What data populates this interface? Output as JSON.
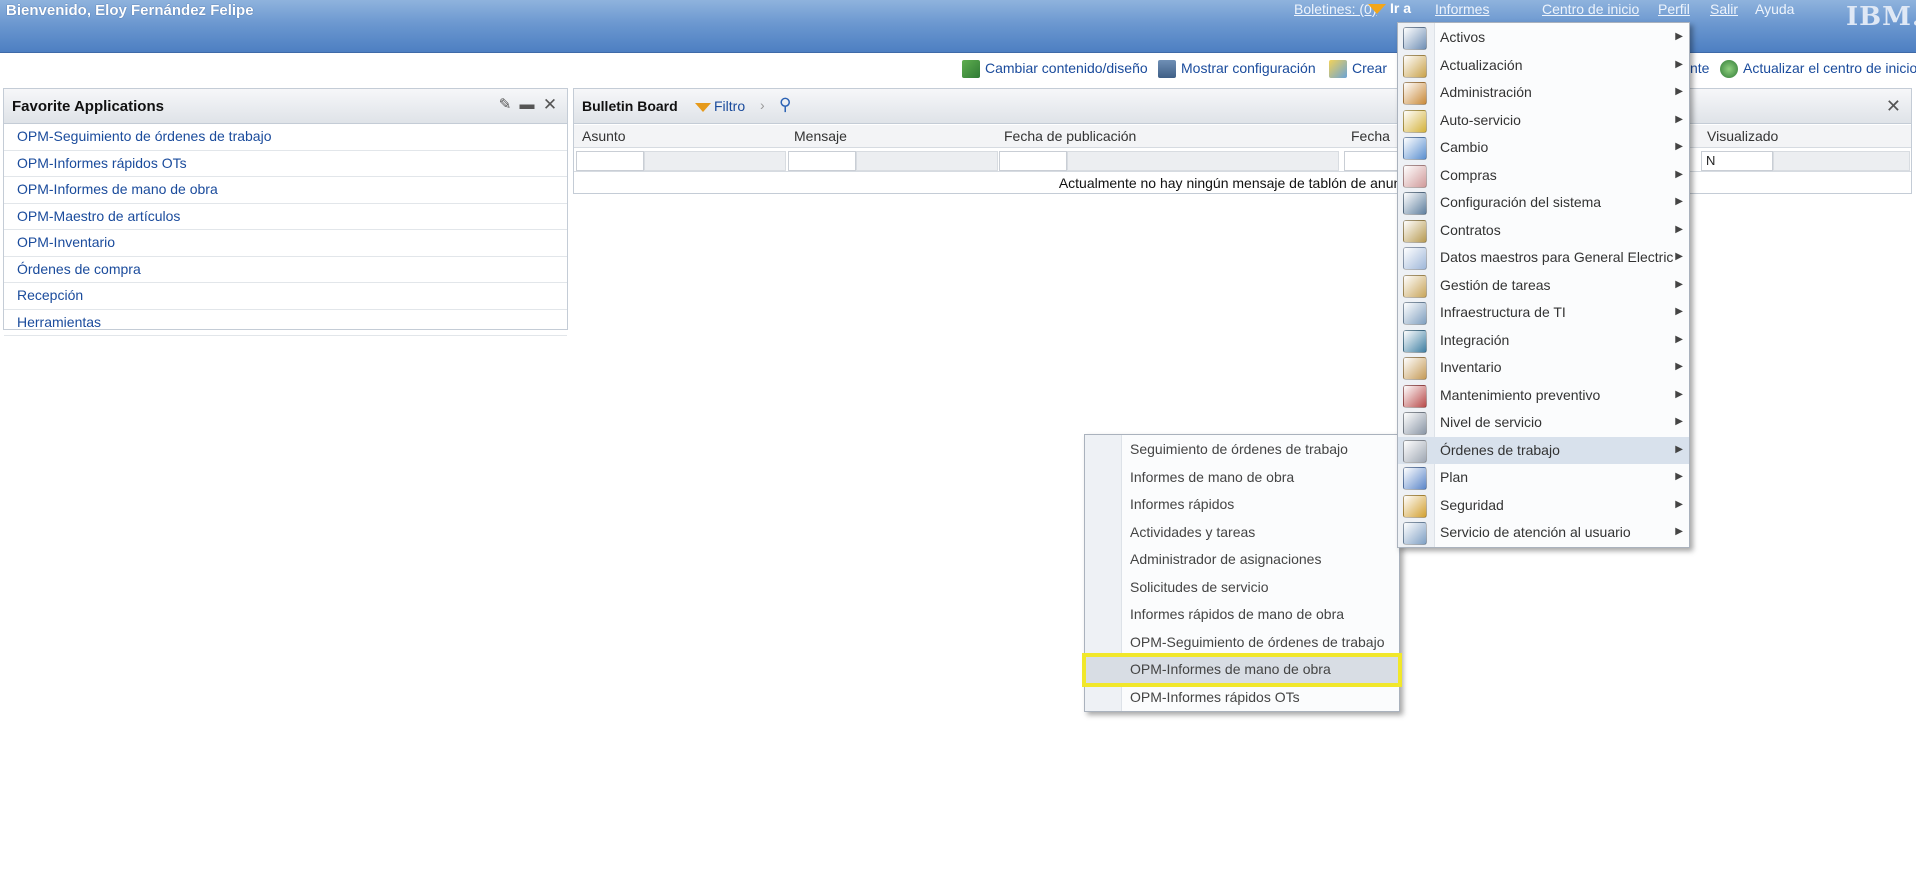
{
  "header": {
    "welcome": "Bienvenido, Eloy Fernández Felipe",
    "bulletins": "Boletines: (0)",
    "goto": "Ir a",
    "reports": "Informes",
    "start_center": "Centro de inicio",
    "profile": "Perfil",
    "signout": "Salir",
    "help": "Ayuda",
    "logo": "IBM."
  },
  "toolbar": {
    "change_layout": "Cambiar contenido/diseño",
    "show_config": "Mostrar configuración",
    "create": "Crear",
    "te": "nte",
    "update_start_center": "Actualizar el centro de inicio"
  },
  "favorites": {
    "title": "Favorite Applications",
    "items": [
      "OPM-Seguimiento de órdenes de trabajo",
      "OPM-Informes rápidos OTs",
      "OPM-Informes de mano de obra",
      "OPM-Maestro de artículos",
      "OPM-Inventario",
      "Órdenes de compra",
      "Recepción",
      "Herramientas"
    ]
  },
  "bulletin": {
    "title": "Bulletin Board",
    "filter": "Filtro",
    "columns": {
      "subject": "Asunto",
      "message": "Mensaje",
      "published": "Fecha de publicación",
      "date": "Fecha",
      "viewed": "Visualizado"
    },
    "viewed_filter": "N",
    "empty": "Actualmente no hay ningún mensaje de tablón de anuncios"
  },
  "goto_menu": {
    "items": [
      "Activos",
      "Actualización",
      "Administración",
      "Auto-servicio",
      "Cambio",
      "Compras",
      "Configuración del sistema",
      "Contratos",
      "Datos maestros para General Electric",
      "Gestión de tareas",
      "Infraestructura de TI",
      "Integración",
      "Inventario",
      "Mantenimiento preventivo",
      "Nivel de servicio",
      "Órdenes de trabajo",
      "Plan",
      "Seguridad",
      "Servicio de atención al usuario"
    ],
    "highlighted": "Órdenes de trabajo",
    "arrow": "▶"
  },
  "submenu": {
    "items": [
      "Seguimiento de órdenes de trabajo",
      "Informes de mano de obra",
      "Informes rápidos",
      "Actividades y tareas",
      "Administrador de asignaciones",
      "Solicitudes de servicio",
      "Informes rápidos de mano de obra",
      "OPM-Seguimiento de órdenes de trabajo",
      "OPM-Informes de mano de obra",
      "OPM-Informes rápidos OTs"
    ],
    "highlighted": "OPM-Informes de mano de obra"
  },
  "colors": {
    "header_blue": "#4d7fc2",
    "link_blue": "#1a4b9c",
    "highlight_yellow": "#f1e72a",
    "goto_orange": "#f3a619"
  },
  "icons": {
    "edit": "pencil-icon",
    "minimize": "minimize-icon",
    "close": "close-icon",
    "search": "search-icon",
    "filter": "filter-icon"
  }
}
